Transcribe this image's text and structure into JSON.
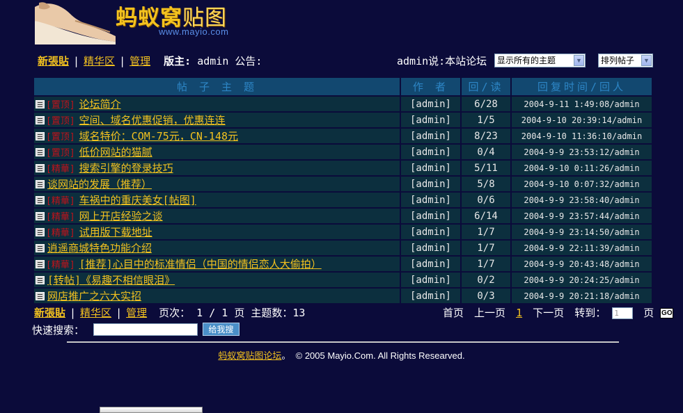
{
  "brand": {
    "title_main": "蚂蚁窝",
    "title_sub": "贴图",
    "url": "www.mayio.com"
  },
  "toolbar": {
    "new_post": "新張貼",
    "elite": "精华区",
    "manage": "管理",
    "moderator_label": "版主:",
    "moderator": "admin",
    "notice_label": "公告:",
    "announcement": "admin说:本站论坛",
    "filter_select": "显示所有的主题",
    "sort_select": "排列帖子"
  },
  "table": {
    "headers": [
      "帖 子 主 题",
      "作 者",
      "回/读",
      "回复时间/回人"
    ],
    "rows": [
      {
        "tag": "[置顶]",
        "title": "论坛简介",
        "author": "[admin]",
        "count": "6/28",
        "time": "2004-9-11 1:49:08/admin"
      },
      {
        "tag": "[置顶]",
        "title": "空间、域名优惠促销，优惠连连",
        "author": "[admin]",
        "count": "1/5",
        "time": "2004-9-10 20:39:14/admin"
      },
      {
        "tag": "[置顶]",
        "title": "域名特价：COM-75元，CN-148元",
        "author": "[admin]",
        "count": "8/23",
        "time": "2004-9-10 11:36:10/admin"
      },
      {
        "tag": "[置顶]",
        "title": "低价网站的猫腻",
        "author": "[admin]",
        "count": "0/4",
        "time": "2004-9-9 23:53:12/admin"
      },
      {
        "tag": "[精華]",
        "title": "搜索引擎的登录技巧",
        "author": "[admin]",
        "count": "5/11",
        "time": "2004-9-10 0:11:26/admin"
      },
      {
        "tag": "",
        "title": "谈网站的发展（推荐）",
        "author": "[admin]",
        "count": "5/8",
        "time": "2004-9-10 0:07:32/admin"
      },
      {
        "tag": "[精華]",
        "title": "车祸中的重庆美女[帖图]",
        "author": "[admin]",
        "count": "0/6",
        "time": "2004-9-9 23:58:40/admin"
      },
      {
        "tag": "[精華]",
        "title": "网上开店经验之谈",
        "author": "[admin]",
        "count": "6/14",
        "time": "2004-9-9 23:57:44/admin"
      },
      {
        "tag": "[精華]",
        "title": "试用版下载地址",
        "author": "[admin]",
        "count": "1/7",
        "time": "2004-9-9 23:14:50/admin"
      },
      {
        "tag": "",
        "title": "逍遥商城特色功能介绍",
        "author": "[admin]",
        "count": "1/7",
        "time": "2004-9-9 22:11:39/admin"
      },
      {
        "tag": "[精華]",
        "title": "[推荐]心目中的标准情侣（中国的情侣恋人大偷拍）",
        "author": "[admin]",
        "count": "1/7",
        "time": "2004-9-9 20:43:48/admin"
      },
      {
        "tag": "",
        "title": "[转帖]《易趣不相信眼泪》",
        "author": "[admin]",
        "count": "0/2",
        "time": "2004-9-9 20:24:25/admin"
      },
      {
        "tag": "",
        "title": "网店推广之六大实招",
        "author": "[admin]",
        "count": "0/3",
        "time": "2004-9-9 20:21:18/admin"
      }
    ]
  },
  "bottom": {
    "new_post": "新張貼",
    "elite": "精华区",
    "manage": "管理",
    "page_info": "页次： 1 / 1 页 主题数：13",
    "first": "首页",
    "prev": "上一页",
    "current": "1",
    "next": "下一页",
    "goto": "转到：",
    "page_input": "1",
    "page_unit": "页",
    "go": "GO"
  },
  "search": {
    "label": "快速搜索：",
    "button": "给我搜"
  },
  "footer": {
    "link": "蚂蚁窝贴图论坛",
    "dot": "。",
    "copyright": "© 2005 Mayio.Com. All Rights Researved."
  },
  "colors": {
    "background": "#0b0b3a",
    "link": "#f3c21f",
    "header_cell": "#124870",
    "row_cell": "#0c2f3e",
    "tag": "#c0131b"
  }
}
